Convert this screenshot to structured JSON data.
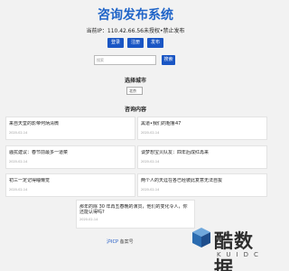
{
  "header": {
    "title": "咨询发布系统",
    "ip_line": "当前IP：110.42.66.56未授权•禁止发布"
  },
  "buttons": [
    "登录",
    "注册",
    "发布"
  ],
  "search": {
    "placeholder": "搜索",
    "button_label": "搜索"
  },
  "city": {
    "label": "选择城市",
    "selected": "北京"
  },
  "content": {
    "label": "咨询内容",
    "cards": [
      {
        "title": "来自天堂的影帝何炳清微",
        "date": "2020-02-14"
      },
      {
        "title": "黑道•我们的粗鲁47",
        "date": "2020-02-14"
      },
      {
        "title": "骚扰建议：春节前最多一道菜",
        "date": "2020-02-14"
      },
      {
        "title": "谈梦想宝贝队友：四年后成红再来",
        "date": "2020-02-14"
      },
      {
        "title": "初三一定记得睡懒觉",
        "date": "2020-02-14"
      },
      {
        "title": "两个人的天涯在各已经彼此复意无法自拔",
        "date": "2020-02-14"
      }
    ],
    "wide_card": {
      "title": "那年的除 30 年再五春晚的演员，他们的变化令人，你还能认得吗?",
      "date": "2020-02-14"
    }
  },
  "footer": {
    "link": "沪ICP",
    "icp": "备案号"
  },
  "watermark": {
    "cn": "酷数据",
    "en": "KUIDC"
  }
}
